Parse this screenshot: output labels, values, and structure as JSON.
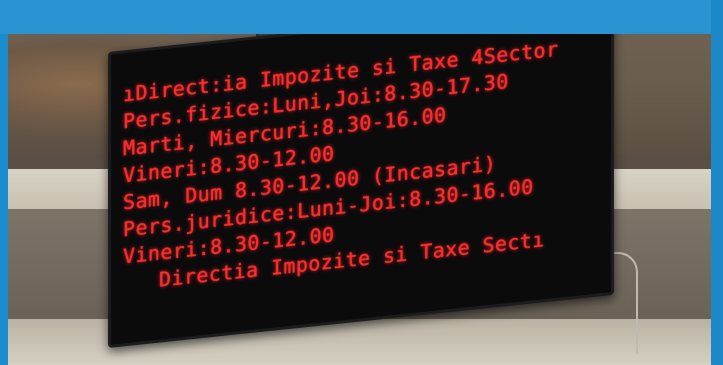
{
  "sign": {
    "lines": [
      "ıDirect:ia Impozite si Taxe 4Sector",
      "Pers.fizice:Luni,Joi:8.30-17.30",
      "Marti, Miercuri:8.30-16.00",
      "Vineri:8.30-12.00",
      "Sam, Dum 8.30-12.00 (Incasari)",
      "Pers.juridice:Luni-Joi:8.30-16.00",
      "Vineri:8.30-12.00",
      "Directia Impozite si Taxe Sectı"
    ]
  },
  "colors": {
    "led_red": "#ff2a2a",
    "panel_black": "#0b0b0c",
    "border_blue": "#1b8ccd"
  }
}
